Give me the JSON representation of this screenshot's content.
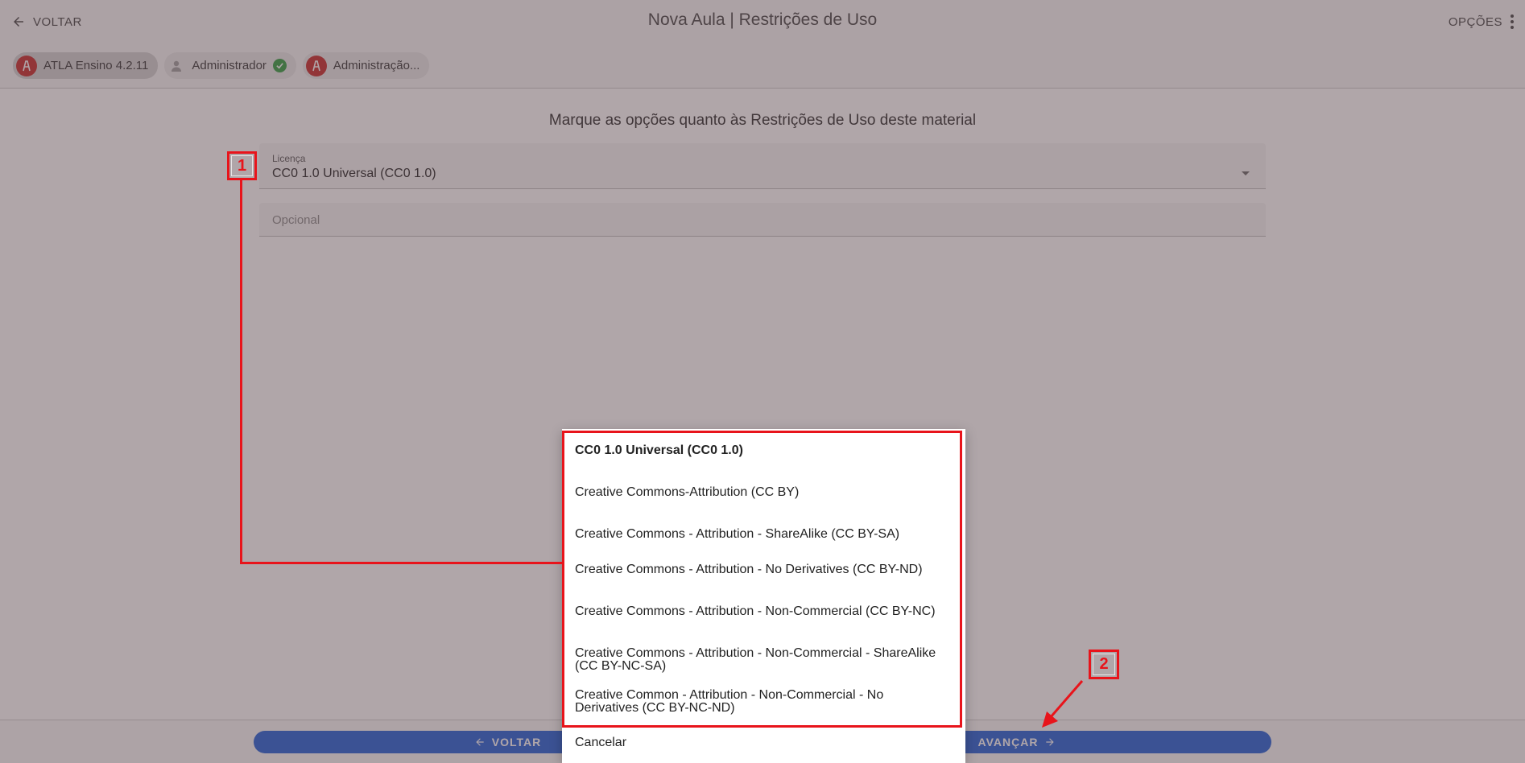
{
  "header": {
    "back_label": "VOLTAR",
    "title": "Nova Aula | Restrições de Uso",
    "options_label": "OPÇÕES"
  },
  "chips": {
    "app": "ATLA Ensino 4.2.11",
    "user": "Administrador",
    "org": "Administração..."
  },
  "content": {
    "heading": "Marque as opções quanto às Restrições de Uso deste material",
    "license_label": "Licença",
    "license_value": "CC0 1.0 Universal (CC0 1.0)",
    "optional_placeholder": "Opcional"
  },
  "footer": {
    "back_label": "VOLTAR",
    "next_label": "AVANÇAR"
  },
  "menu": {
    "options": [
      "CC0 1.0 Universal (CC0 1.0)",
      "Creative Commons-Attribution (CC BY)",
      "Creative Commons - Attribution - ShareAlike (CC BY-SA)",
      "Creative Commons - Attribution - No Derivatives (CC BY-ND)",
      "Creative Commons - Attribution - Non-Commercial (CC BY-NC)",
      "Creative Commons - Attribution - Non-Commercial - ShareAlike (CC BY-NC-SA)",
      "Creative Common - Attribution - Non-Commercial - No Derivatives (CC BY-NC-ND)"
    ],
    "selected_index": 0,
    "cancel_label": "Cancelar"
  },
  "annotations": {
    "marker_1": "1",
    "marker_2": "2",
    "color": "#e8141b"
  },
  "colors": {
    "primary": "#1f5fd6",
    "chip_avatar": "#c62828",
    "verified": "#2e9d3f"
  },
  "icons": [
    "arrow-left-icon",
    "kebab-menu-icon",
    "atla-logo-icon",
    "user-icon",
    "check-circle-icon",
    "caret-down-icon",
    "arrow-right-icon"
  ]
}
